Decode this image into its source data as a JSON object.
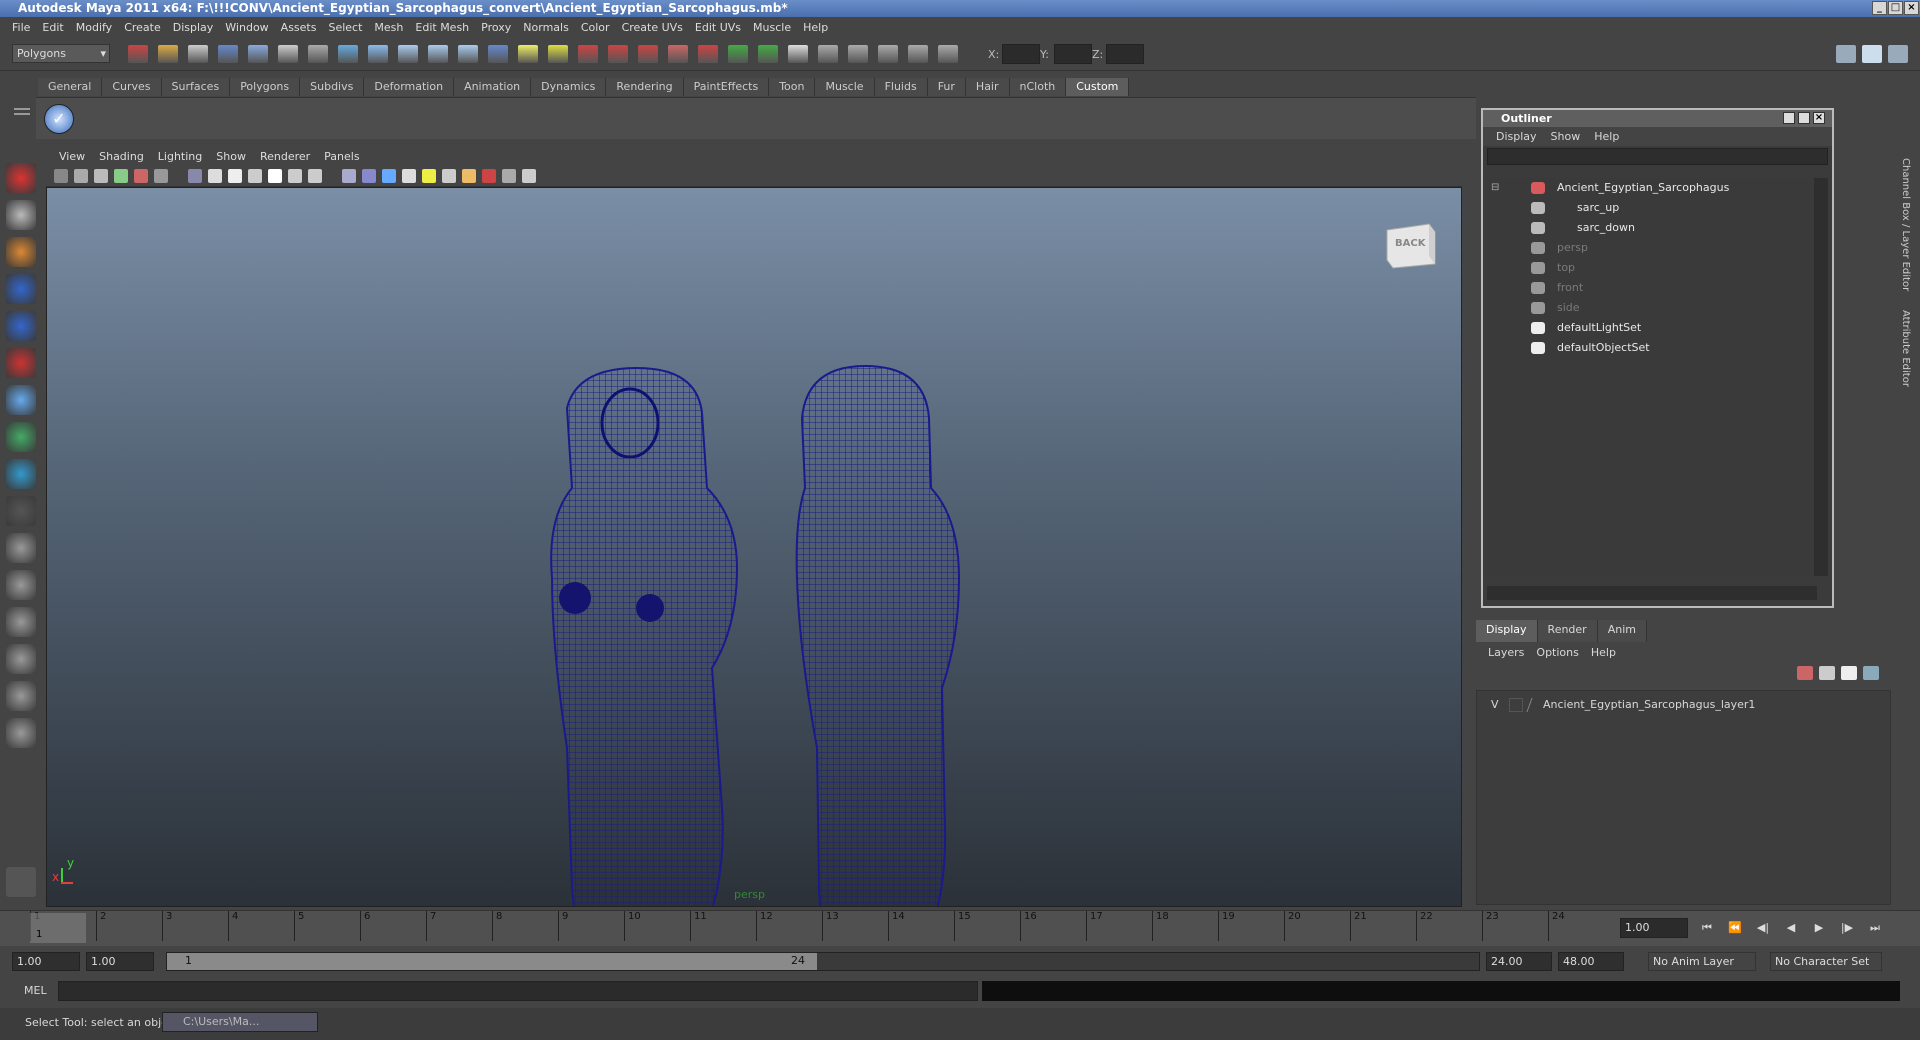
{
  "window": {
    "title": "Autodesk Maya 2011 x64: F:\\!!!CONV\\Ancient_Egyptian_Sarcophagus_convert\\Ancient_Egyptian_Sarcophagus.mb*"
  },
  "menubar": [
    "File",
    "Edit",
    "Modify",
    "Create",
    "Display",
    "Window",
    "Assets",
    "Select",
    "Mesh",
    "Edit Mesh",
    "Proxy",
    "Normals",
    "Color",
    "Create UVs",
    "Edit UVs",
    "Muscle",
    "Help"
  ],
  "statusline": {
    "mode": "Polygons",
    "x_label": "X:",
    "y_label": "Y:",
    "z_label": "Z:"
  },
  "shelf_tabs": [
    "General",
    "Curves",
    "Surfaces",
    "Polygons",
    "Subdivs",
    "Deformation",
    "Animation",
    "Dynamics",
    "Rendering",
    "PaintEffects",
    "Toon",
    "Muscle",
    "Fluids",
    "Fur",
    "Hair",
    "nCloth",
    "Custom"
  ],
  "shelf_active": "Custom",
  "viewport": {
    "menu": [
      "View",
      "Shading",
      "Lighting",
      "Show",
      "Renderer",
      "Panels"
    ],
    "camera_label": "persp",
    "viewcube_label": "BACK",
    "axis_x": "x",
    "axis_y": "y",
    "wire_color": "#1a1a8c"
  },
  "outliner": {
    "title": "Outliner",
    "menu": [
      "Display",
      "Show",
      "Help"
    ],
    "items": [
      {
        "label": "Ancient_Egyptian_Sarcophagus",
        "depth": 0,
        "dim": false,
        "icon": "group-icon",
        "expander": "⊟"
      },
      {
        "label": "sarc_up",
        "depth": 1,
        "dim": false,
        "icon": "mesh-icon",
        "expander": ""
      },
      {
        "label": "sarc_down",
        "depth": 1,
        "dim": false,
        "icon": "mesh-icon",
        "expander": ""
      },
      {
        "label": "persp",
        "depth": 0,
        "dim": true,
        "icon": "camera-icon",
        "expander": ""
      },
      {
        "label": "top",
        "depth": 0,
        "dim": true,
        "icon": "camera-icon",
        "expander": ""
      },
      {
        "label": "front",
        "depth": 0,
        "dim": true,
        "icon": "camera-icon",
        "expander": ""
      },
      {
        "label": "side",
        "depth": 0,
        "dim": true,
        "icon": "camera-icon",
        "expander": ""
      },
      {
        "label": "defaultLightSet",
        "depth": 0,
        "dim": false,
        "icon": "set-icon",
        "expander": ""
      },
      {
        "label": "defaultObjectSet",
        "depth": 0,
        "dim": false,
        "icon": "set-icon",
        "expander": ""
      }
    ]
  },
  "side_tabs": [
    "Channel Box / Layer Editor",
    "Attribute Editor"
  ],
  "layer_editor": {
    "tabs": [
      "Display",
      "Render",
      "Anim"
    ],
    "active_tab": "Display",
    "menu": [
      "Layers",
      "Options",
      "Help"
    ],
    "layers": [
      {
        "visible": "V",
        "name": "Ancient_Egyptian_Sarcophagus_layer1"
      }
    ]
  },
  "timeslider": {
    "frames": [
      "1",
      "2",
      "3",
      "4",
      "5",
      "6",
      "7",
      "8",
      "9",
      "10",
      "11",
      "12",
      "13",
      "14",
      "15",
      "16",
      "17",
      "18",
      "19",
      "20",
      "21",
      "22",
      "23",
      "24"
    ],
    "current_frame": "1",
    "current_time": "1.00"
  },
  "rangeslider": {
    "start": "1.00",
    "playback_start": "1.00",
    "range_start_label": "1",
    "range_end_label": "24",
    "playback_end": "24.00",
    "end": "48.00",
    "anim_layer": "No Anim Layer",
    "character_set": "No Character Set"
  },
  "cmdline": {
    "label": "MEL"
  },
  "helpline": {
    "text": "Select Tool: select an object",
    "task": "C:\\Users\\Ma..."
  }
}
